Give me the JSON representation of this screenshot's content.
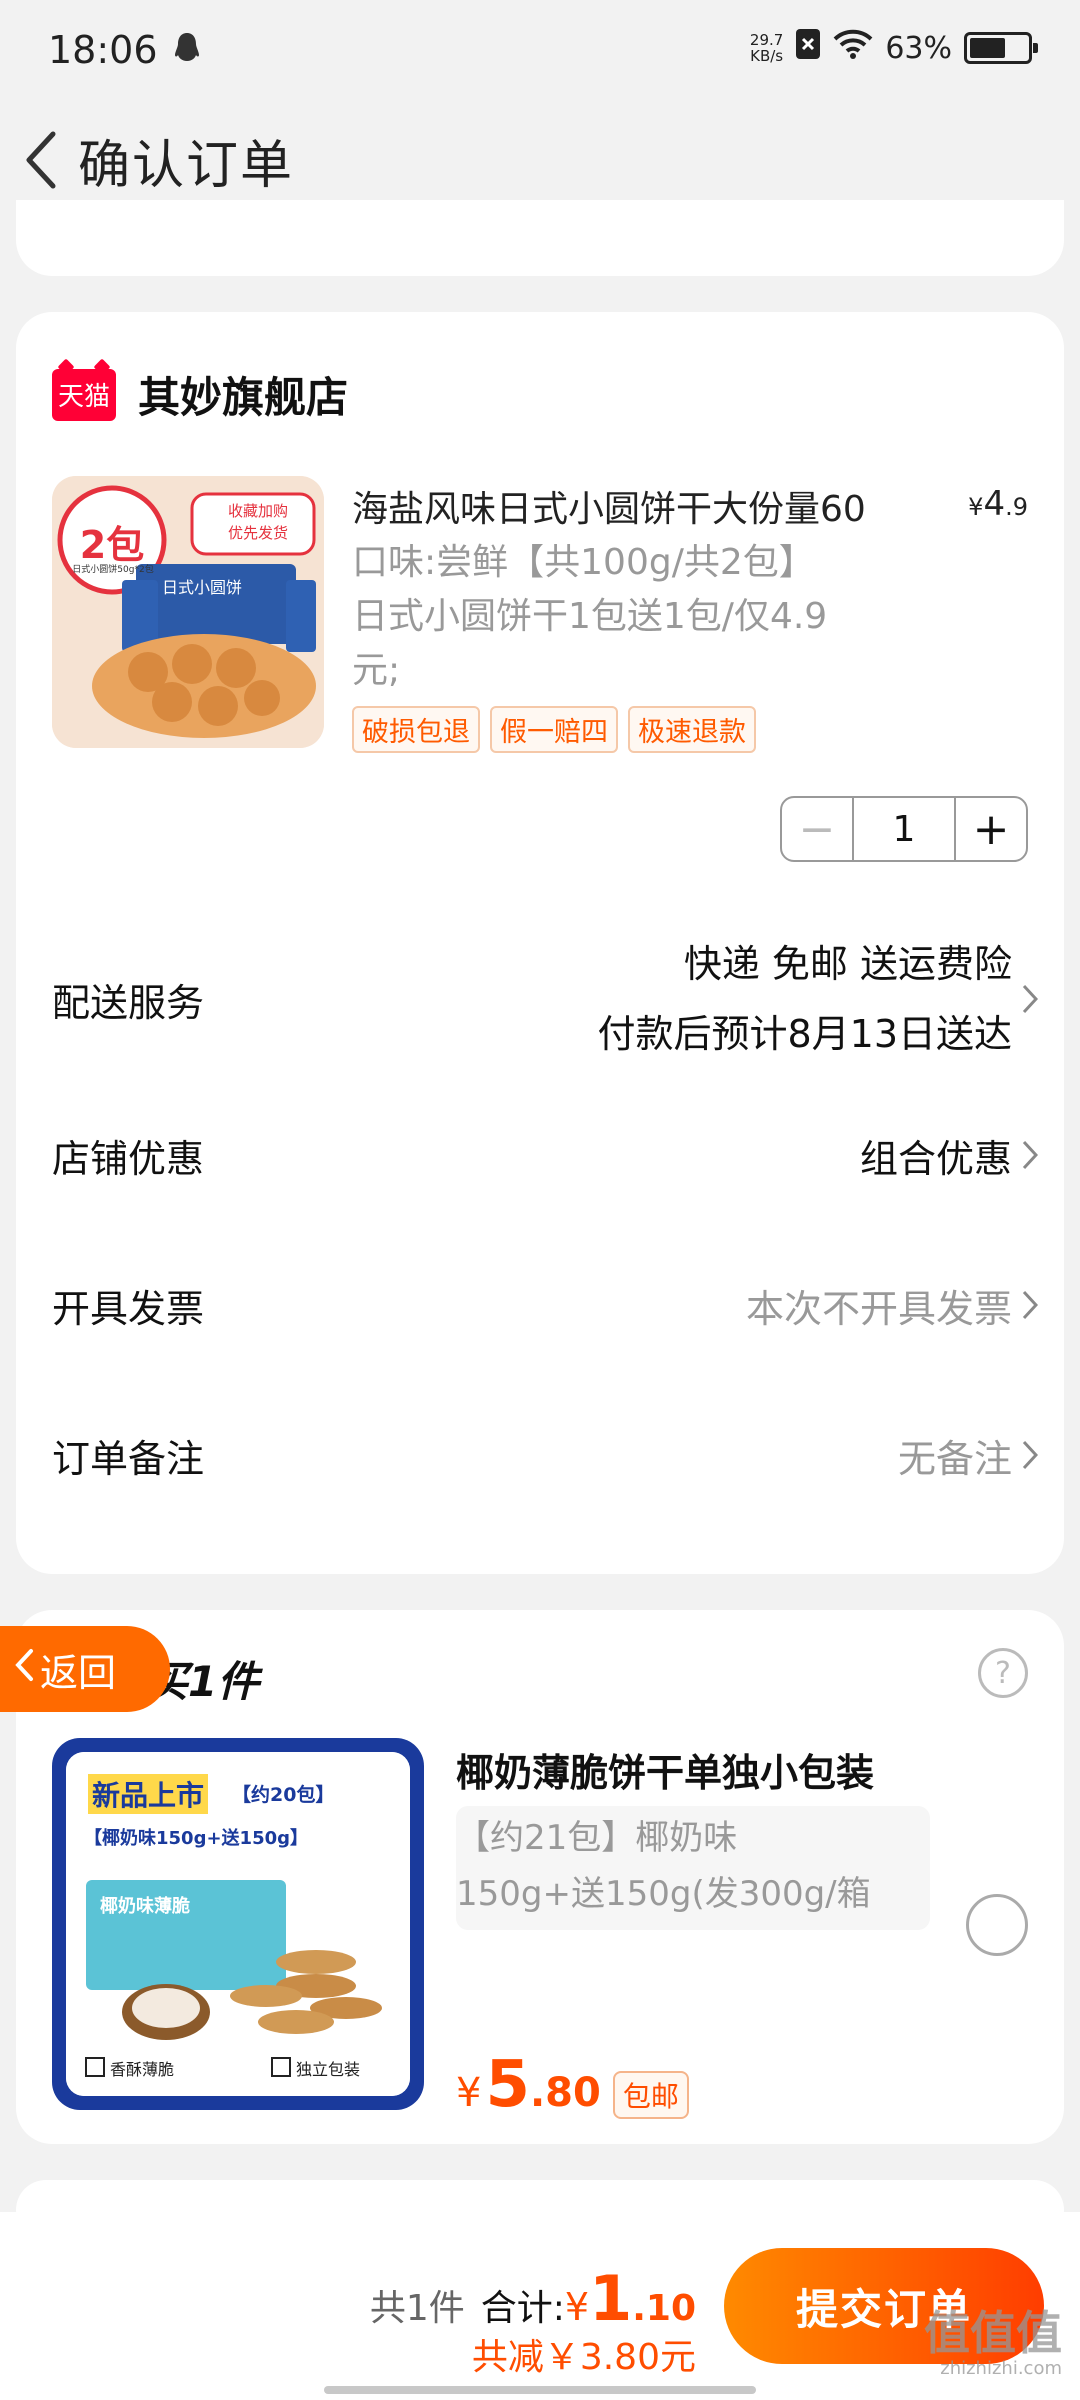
{
  "status_bar": {
    "time": "18:06",
    "net_speed_value": "29.7",
    "net_speed_unit": "KB/s",
    "battery": "63%",
    "battery_level": 0.63
  },
  "header": {
    "title": "确认订单"
  },
  "store": {
    "badge": "天猫",
    "name": "其妙旗舰店",
    "product": {
      "title": "海盐风味日式小圆饼干大份量60",
      "price_currency": "¥",
      "price_int": "4",
      "price_dec": ".9",
      "spec_lines": [
        "口味:尝鲜【共100g/共2包】",
        "日式小圆饼干1包送1包/仅4.9",
        "元;"
      ],
      "image_text": {
        "count": "2包",
        "caption": "日式小圆饼50g*2包",
        "banner_line1": "收藏加购",
        "banner_line2": "优先发货",
        "box_label": "日式小圆饼"
      },
      "tags": [
        "破损包退",
        "假一赔四",
        "极速退款"
      ],
      "quantity": "1",
      "minus": "−",
      "plus": "+"
    },
    "rows": {
      "delivery": {
        "label": "配送服务",
        "value_line1": "快递 免邮 送运费险",
        "value_line2": "付款后预计8月13日送达"
      },
      "discount": {
        "label": "店铺优惠",
        "value": "组合优惠"
      },
      "invoice": {
        "label": "开具发票",
        "value": "本次不开具发票"
      },
      "note": {
        "label": "订单备注",
        "value": "无备注"
      }
    }
  },
  "recommend": {
    "heading": "买1件",
    "help": "?",
    "title": "椰奶薄脆饼干单独小包装",
    "spec_lines": [
      "【约21包】椰奶味",
      "150g+送150g(发300g/箱"
    ],
    "price_currency": "¥",
    "price_int": "5",
    "price_dec": ".80",
    "badge": "包邮",
    "image_text": {
      "headline": "新品上市",
      "sub": "【约20包】",
      "promo": "【椰奶味150g+送150g】",
      "box": "椰奶味薄脆",
      "check1": "香酥薄脆",
      "check2": "独立包装"
    }
  },
  "float_back": {
    "label": "返回"
  },
  "bottom": {
    "count": "共1件",
    "total_label": "合计:",
    "total_currency": "¥",
    "total_int": "1",
    "total_dec": ".10",
    "saved": "共减￥3.80元",
    "submit": "提交订单",
    "watermark": "值值值",
    "watermark_url": "zhizhizhi.com"
  },
  "colors": {
    "accent": "#ff4d00",
    "tmall_red": "#ff0036",
    "background": "#f2f2f2"
  }
}
